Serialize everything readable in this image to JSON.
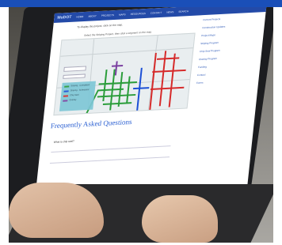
{
  "top_band_color": "#1a4fb8",
  "screen": {
    "nav": {
      "logo": "MoDOT",
      "items": [
        "HOME",
        "ABOUT",
        "PROJECTS",
        "MAPS",
        "RESOURCES",
        "CONTACT",
        "NEWS",
        "SEARCH"
      ]
    },
    "instruction_line_1": "To display the project, click on the map.",
    "instruction_line_2": "Select the Striping Project, then click a segment on the map.",
    "map": {
      "legend_items": [
        "Striping - Completed",
        "Striping - Scheduled",
        "Chip Seal",
        "Overlay"
      ],
      "legend_colors": [
        "#2a9d3a",
        "#1b4fd6",
        "#d62a2a",
        "#7a3fa0"
      ]
    },
    "sidebar_links": [
      "Current Projects",
      "Construction Updates",
      "Project Maps",
      "Striping Program",
      "Chip Seal Program",
      "Overlay Program",
      "Funding",
      "Contact",
      "Forms"
    ],
    "faq_title": "Frequently Asked Questions",
    "faq_first_question": "What is chip seal?"
  }
}
